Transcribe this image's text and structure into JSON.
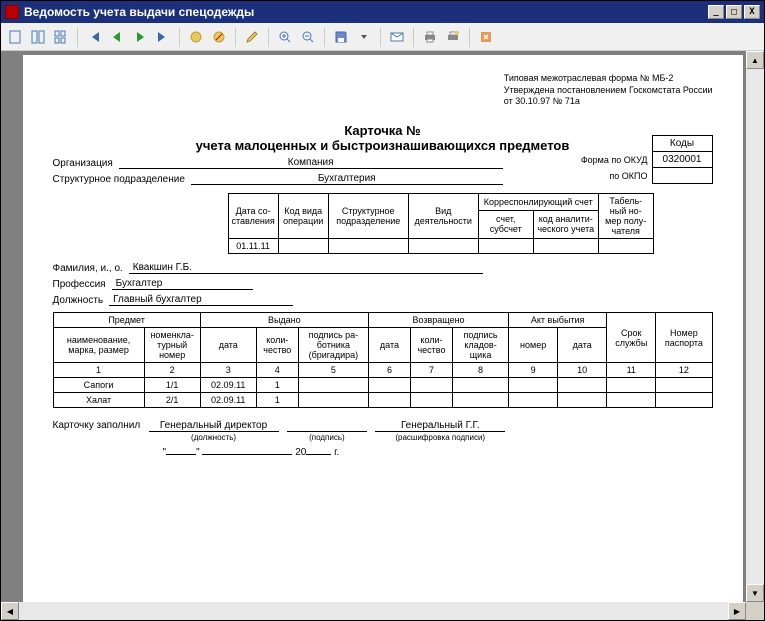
{
  "window": {
    "title": "Ведомость учета выдачи спецодежды"
  },
  "form_note": {
    "l1": "Типовая межотраслевая форма № МБ-2",
    "l2": "Утверждена постановлением Госкомстата России",
    "l3": "от 30.10.97 № 71а"
  },
  "title": {
    "l1": "Карточка  №",
    "l2": "учета малоценных и быстроизнашивающихся предметов"
  },
  "codes": {
    "hdr": "Коды",
    "okud_lbl": "Форма по ОКУД",
    "okud_val": "0320001",
    "okpo_lbl": "по ОКПО",
    "okpo_val": ""
  },
  "org": {
    "lbl": "Организация",
    "val": "Компания"
  },
  "dept": {
    "lbl": "Структурное подразделение",
    "val": "Бухгалтерия"
  },
  "mid_hdr": {
    "c1a": "Дата со-",
    "c1b": "ставления",
    "c2a": "Код вида",
    "c2b": "операции",
    "c3a": "Структурное",
    "c3b": "подразделение",
    "c4a": "Вид",
    "c4b": "деятельности",
    "c5": "Корреспонлирующий счет",
    "c5a": "счет,",
    "c5a2": "субсчет",
    "c5b": "код аналити-",
    "c5b2": "ческого учета",
    "c6a": "Табель-",
    "c6b": "ный но-",
    "c6c": "мер полу-",
    "c6d": "чателя"
  },
  "mid_row": {
    "date": "01.11.11",
    "c2": "",
    "c3": "",
    "c4": "",
    "c5a": "",
    "c5b": "",
    "c6": ""
  },
  "person": {
    "fio_lbl": "Фамилия, и., о.",
    "fio": "Квакшин Г.Б.",
    "prof_lbl": "Профессия",
    "prof": "Бухгалтер",
    "pos_lbl": "Должность",
    "pos": "Главный бухгалтер"
  },
  "items_hdr": {
    "g1": "Предмет",
    "g2": "Выдано",
    "g3": "Возвращено",
    "g4": "Акт выбытия",
    "c1a": "наименование,",
    "c1b": "марка, размер",
    "c2a": "номенкла-",
    "c2b": "турный",
    "c2c": "номер",
    "c3": "дата",
    "c4a": "коли-",
    "c4b": "чество",
    "c5a": "подпись ра-",
    "c5b": "ботника",
    "c5c": "(бригадира)",
    "c6": "дата",
    "c7a": "коли-",
    "c7b": "чество",
    "c8a": "подпись",
    "c8b": "кладов-",
    "c8c": "щика",
    "c9": "номер",
    "c10": "дата",
    "c11a": "Срок",
    "c11b": "службы",
    "c12a": "Номер",
    "c12b": "паспорта",
    "n1": "1",
    "n2": "2",
    "n3": "3",
    "n4": "4",
    "n5": "5",
    "n6": "6",
    "n7": "7",
    "n8": "8",
    "n9": "9",
    "n10": "10",
    "n11": "11",
    "n12": "12"
  },
  "rows": [
    {
      "name": "Сапоги",
      "nom": "1/1",
      "date": "02.09.11",
      "qty": "1"
    },
    {
      "name": "Халат",
      "nom": "2/1",
      "date": "02.09.11",
      "qty": "1"
    }
  ],
  "footer": {
    "lbl": "Карточку заполнил",
    "pos": "Генеральный директор",
    "pos_cap": "(должность)",
    "sig": "",
    "sig_cap": "(подпись)",
    "dec": "Генеральный Г.Г.",
    "dec_cap": "(расшифровка подписи)",
    "q1": "\"",
    "q2": "\"",
    "y": "20",
    "g": "г."
  }
}
